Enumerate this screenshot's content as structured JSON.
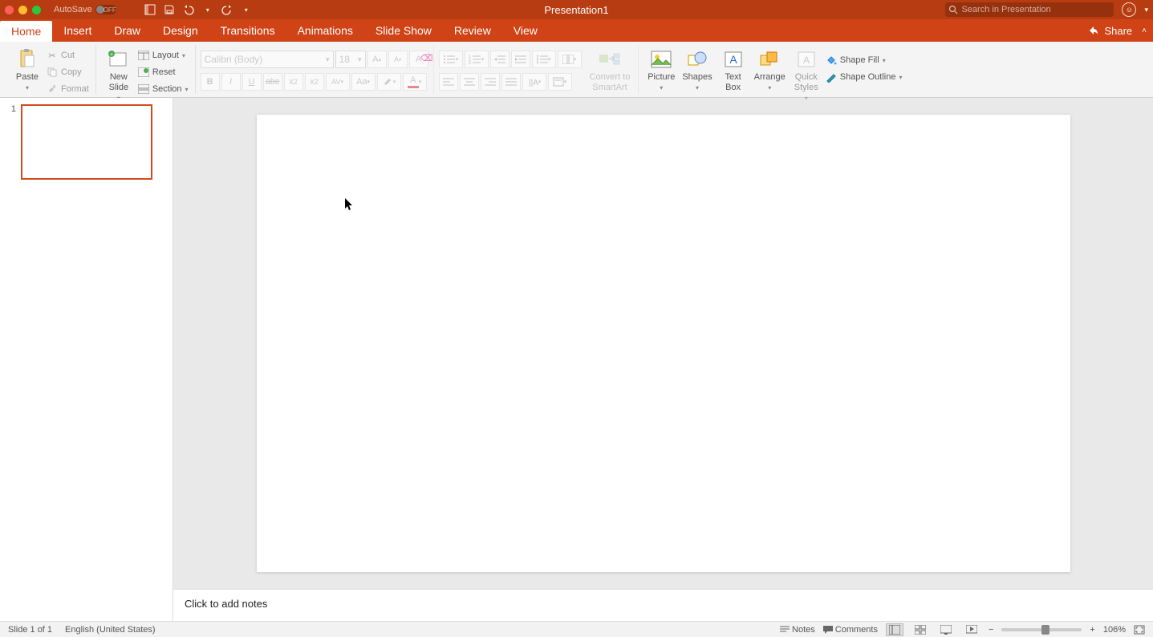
{
  "title": "Presentation1",
  "autosave": {
    "label": "AutoSave",
    "state": "OFF"
  },
  "search_placeholder": "Search in Presentation",
  "tabs": [
    "Home",
    "Insert",
    "Draw",
    "Design",
    "Transitions",
    "Animations",
    "Slide Show",
    "Review",
    "View"
  ],
  "share_label": "Share",
  "ribbon": {
    "paste": "Paste",
    "cut": "Cut",
    "copy": "Copy",
    "format": "Format",
    "new_slide": "New\nSlide",
    "layout": "Layout",
    "reset": "Reset",
    "section": "Section",
    "font_name": "Calibri (Body)",
    "font_size": "18",
    "convert_smartart": "Convert to\nSmartArt",
    "picture": "Picture",
    "shapes": "Shapes",
    "text_box": "Text\nBox",
    "arrange": "Arrange",
    "quick_styles": "Quick\nStyles",
    "shape_fill": "Shape Fill",
    "shape_outline": "Shape Outline"
  },
  "thumb_number": "1",
  "notes_placeholder": "Click to add notes",
  "status": {
    "slide": "Slide 1 of 1",
    "lang": "English (United States)",
    "notes": "Notes",
    "comments": "Comments",
    "zoom": "106%"
  }
}
